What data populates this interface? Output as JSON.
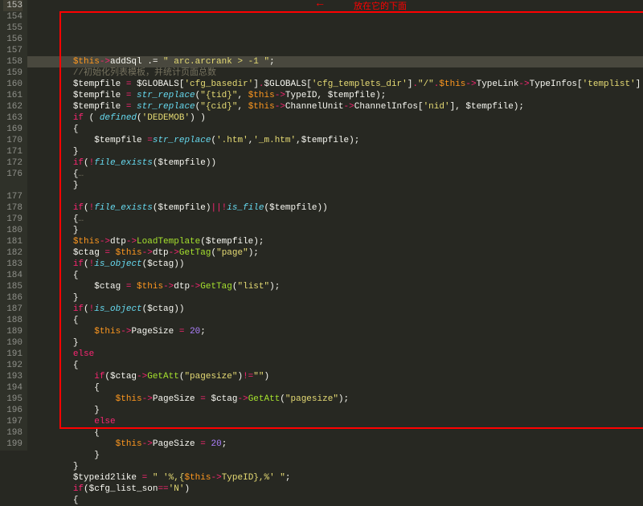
{
  "annotation": {
    "text": "放在它的下面",
    "arrow": "←"
  },
  "lines": [
    {
      "num": "153",
      "active": true,
      "sel": true,
      "tokens": [
        [
          "",
          "        "
        ],
        [
          "orange",
          "$this"
        ],
        [
          "red",
          "->"
        ],
        [
          "white",
          "addSql"
        ],
        [
          "white",
          " .= "
        ],
        [
          "yellow",
          "\" arc.arcrank > -1 \""
        ],
        [
          "white",
          ";"
        ]
      ]
    },
    {
      "num": "154",
      "tokens": [
        [
          "",
          "        "
        ],
        [
          "gray",
          "//初始化列表模板，并统计页面总数"
        ]
      ]
    },
    {
      "num": "155",
      "tokens": [
        [
          "",
          "        "
        ],
        [
          "white",
          "$tempfile "
        ],
        [
          "red",
          "="
        ],
        [
          "white",
          " $GLOBALS["
        ],
        [
          "yellow",
          "'cfg_basedir'"
        ],
        [
          "white",
          "]"
        ],
        [
          "red",
          "."
        ],
        [
          "white",
          "$GLOBALS["
        ],
        [
          "yellow",
          "'cfg_templets_dir'"
        ],
        [
          "white",
          "]"
        ],
        [
          "red",
          "."
        ],
        [
          "yellow",
          "\"/\""
        ],
        [
          "red",
          "."
        ],
        [
          "orange",
          "$this"
        ],
        [
          "red",
          "->"
        ],
        [
          "white",
          "TypeLink"
        ],
        [
          "red",
          "->"
        ],
        [
          "white",
          "TypeInfos["
        ],
        [
          "yellow",
          "'templist'"
        ],
        [
          "white",
          "]"
        ]
      ]
    },
    {
      "num": "156",
      "tokens": [
        [
          "",
          "        "
        ],
        [
          "white",
          "$tempfile "
        ],
        [
          "red",
          "="
        ],
        [
          "white",
          " "
        ],
        [
          "blue",
          "str_replace"
        ],
        [
          "white",
          "("
        ],
        [
          "yellow",
          "\"{tid}\""
        ],
        [
          "white",
          ", "
        ],
        [
          "orange",
          "$this"
        ],
        [
          "red",
          "->"
        ],
        [
          "white",
          "TypeID, $tempfile);"
        ]
      ]
    },
    {
      "num": "157",
      "tokens": [
        [
          "",
          "        "
        ],
        [
          "white",
          "$tempfile "
        ],
        [
          "red",
          "="
        ],
        [
          "white",
          " "
        ],
        [
          "blue",
          "str_replace"
        ],
        [
          "white",
          "("
        ],
        [
          "yellow",
          "\"{cid}\""
        ],
        [
          "white",
          ", "
        ],
        [
          "orange",
          "$this"
        ],
        [
          "red",
          "->"
        ],
        [
          "white",
          "ChannelUnit"
        ],
        [
          "red",
          "->"
        ],
        [
          "white",
          "ChannelInfos["
        ],
        [
          "yellow",
          "'nid'"
        ],
        [
          "white",
          "], $tempfile);"
        ]
      ]
    },
    {
      "num": "158",
      "tokens": [
        [
          "",
          "        "
        ],
        [
          "red",
          "if"
        ],
        [
          "white",
          " ( "
        ],
        [
          "blue",
          "defined"
        ],
        [
          "white",
          "("
        ],
        [
          "yellow",
          "'DEDEMOB'"
        ],
        [
          "white",
          ") )"
        ]
      ]
    },
    {
      "num": "159",
      "tokens": [
        [
          "",
          "        "
        ],
        [
          "white",
          "{"
        ]
      ]
    },
    {
      "num": "160",
      "tokens": [
        [
          "",
          "            "
        ],
        [
          "white",
          "$tempfile "
        ],
        [
          "red",
          "="
        ],
        [
          "blue",
          "str_replace"
        ],
        [
          "white",
          "("
        ],
        [
          "yellow",
          "'.htm'"
        ],
        [
          "white",
          ","
        ],
        [
          "yellow",
          "'_m.htm'"
        ],
        [
          "white",
          ",$tempfile);"
        ]
      ]
    },
    {
      "num": "161",
      "tokens": [
        [
          "",
          "        "
        ],
        [
          "white",
          "}"
        ]
      ]
    },
    {
      "num": "162",
      "tokens": [
        [
          "",
          "        "
        ],
        [
          "red",
          "if"
        ],
        [
          "white",
          "("
        ],
        [
          "red",
          "!"
        ],
        [
          "blue",
          "file_exists"
        ],
        [
          "white",
          "($tempfile))"
        ]
      ]
    },
    {
      "num": "163",
      "tokens": [
        [
          "",
          "        "
        ],
        [
          "white",
          "{"
        ],
        [
          "gray",
          "…"
        ]
      ]
    },
    {
      "num": "169",
      "tokens": [
        [
          "",
          "        "
        ],
        [
          "white",
          "}"
        ]
      ]
    },
    {
      "num": "170",
      "tokens": [
        [
          "",
          ""
        ]
      ]
    },
    {
      "num": "171",
      "tokens": [
        [
          "",
          "        "
        ],
        [
          "red",
          "if"
        ],
        [
          "white",
          "("
        ],
        [
          "red",
          "!"
        ],
        [
          "blue",
          "file_exists"
        ],
        [
          "white",
          "($tempfile)"
        ],
        [
          "red",
          "||!"
        ],
        [
          "blue",
          "is_file"
        ],
        [
          "white",
          "($tempfile))"
        ]
      ]
    },
    {
      "num": "172",
      "tokens": [
        [
          "",
          "        "
        ],
        [
          "white",
          "{"
        ],
        [
          "gray",
          "…"
        ]
      ]
    },
    {
      "num": "176",
      "tokens": [
        [
          "",
          "        "
        ],
        [
          "white",
          "}"
        ]
      ]
    },
    {
      "num": "176b",
      "num_display": "176",
      "skip_num": true,
      "tokens": [
        [
          "",
          "        "
        ],
        [
          "orange",
          "$this"
        ],
        [
          "red",
          "->"
        ],
        [
          "white",
          "dtp"
        ],
        [
          "red",
          "->"
        ],
        [
          "green",
          "LoadTemplate"
        ],
        [
          "white",
          "($tempfile);"
        ]
      ]
    },
    {
      "num": "177",
      "tokens": [
        [
          "",
          "        "
        ],
        [
          "white",
          "$ctag "
        ],
        [
          "red",
          "="
        ],
        [
          "white",
          " "
        ],
        [
          "orange",
          "$this"
        ],
        [
          "red",
          "->"
        ],
        [
          "white",
          "dtp"
        ],
        [
          "red",
          "->"
        ],
        [
          "green",
          "GetTag"
        ],
        [
          "white",
          "("
        ],
        [
          "yellow",
          "\"page\""
        ],
        [
          "white",
          ");"
        ]
      ]
    },
    {
      "num": "178",
      "tokens": [
        [
          "",
          "        "
        ],
        [
          "red",
          "if"
        ],
        [
          "white",
          "("
        ],
        [
          "red",
          "!"
        ],
        [
          "blue",
          "is_object"
        ],
        [
          "white",
          "($ctag))"
        ]
      ]
    },
    {
      "num": "179",
      "tokens": [
        [
          "",
          "        "
        ],
        [
          "white",
          "{"
        ]
      ]
    },
    {
      "num": "180",
      "tokens": [
        [
          "",
          "            "
        ],
        [
          "white",
          "$ctag "
        ],
        [
          "red",
          "="
        ],
        [
          "white",
          " "
        ],
        [
          "orange",
          "$this"
        ],
        [
          "red",
          "->"
        ],
        [
          "white",
          "dtp"
        ],
        [
          "red",
          "->"
        ],
        [
          "green",
          "GetTag"
        ],
        [
          "white",
          "("
        ],
        [
          "yellow",
          "\"list\""
        ],
        [
          "white",
          ");"
        ]
      ]
    },
    {
      "num": "181",
      "tokens": [
        [
          "",
          "        "
        ],
        [
          "white",
          "}"
        ]
      ]
    },
    {
      "num": "182",
      "tokens": [
        [
          "",
          "        "
        ],
        [
          "red",
          "if"
        ],
        [
          "white",
          "("
        ],
        [
          "red",
          "!"
        ],
        [
          "blue",
          "is_object"
        ],
        [
          "white",
          "($ctag))"
        ]
      ]
    },
    {
      "num": "183",
      "tokens": [
        [
          "",
          "        "
        ],
        [
          "white",
          "{"
        ]
      ]
    },
    {
      "num": "184",
      "tokens": [
        [
          "",
          "            "
        ],
        [
          "orange",
          "$this"
        ],
        [
          "red",
          "->"
        ],
        [
          "white",
          "PageSize "
        ],
        [
          "red",
          "="
        ],
        [
          "white",
          " "
        ],
        [
          "purple",
          "20"
        ],
        [
          "white",
          ";"
        ]
      ]
    },
    {
      "num": "185",
      "tokens": [
        [
          "",
          "        "
        ],
        [
          "white",
          "}"
        ]
      ]
    },
    {
      "num": "186",
      "tokens": [
        [
          "",
          "        "
        ],
        [
          "red",
          "else"
        ]
      ]
    },
    {
      "num": "187",
      "tokens": [
        [
          "",
          "        "
        ],
        [
          "white",
          "{"
        ]
      ]
    },
    {
      "num": "188",
      "tokens": [
        [
          "",
          "            "
        ],
        [
          "red",
          "if"
        ],
        [
          "white",
          "($ctag"
        ],
        [
          "red",
          "->"
        ],
        [
          "green",
          "GetAtt"
        ],
        [
          "white",
          "("
        ],
        [
          "yellow",
          "\"pagesize\""
        ],
        [
          "white",
          ")"
        ],
        [
          "red",
          "!="
        ],
        [
          "yellow",
          "\"\""
        ],
        [
          "white",
          ")"
        ]
      ]
    },
    {
      "num": "189",
      "tokens": [
        [
          "",
          "            "
        ],
        [
          "white",
          "{"
        ]
      ]
    },
    {
      "num": "190",
      "tokens": [
        [
          "",
          "                "
        ],
        [
          "orange",
          "$this"
        ],
        [
          "red",
          "->"
        ],
        [
          "white",
          "PageSize "
        ],
        [
          "red",
          "="
        ],
        [
          "white",
          " $ctag"
        ],
        [
          "red",
          "->"
        ],
        [
          "green",
          "GetAtt"
        ],
        [
          "white",
          "("
        ],
        [
          "yellow",
          "\"pagesize\""
        ],
        [
          "white",
          ");"
        ]
      ]
    },
    {
      "num": "191",
      "tokens": [
        [
          "",
          "            "
        ],
        [
          "white",
          "}"
        ]
      ]
    },
    {
      "num": "192",
      "tokens": [
        [
          "",
          "            "
        ],
        [
          "red",
          "else"
        ]
      ]
    },
    {
      "num": "193",
      "tokens": [
        [
          "",
          "            "
        ],
        [
          "white",
          "{"
        ]
      ]
    },
    {
      "num": "194",
      "tokens": [
        [
          "",
          "                "
        ],
        [
          "orange",
          "$this"
        ],
        [
          "red",
          "->"
        ],
        [
          "white",
          "PageSize "
        ],
        [
          "red",
          "="
        ],
        [
          "white",
          " "
        ],
        [
          "purple",
          "20"
        ],
        [
          "white",
          ";"
        ]
      ]
    },
    {
      "num": "195",
      "tokens": [
        [
          "",
          "            "
        ],
        [
          "white",
          "}"
        ]
      ]
    },
    {
      "num": "196",
      "tokens": [
        [
          "",
          "        "
        ],
        [
          "white",
          "}"
        ]
      ]
    },
    {
      "num": "197",
      "tokens": [
        [
          "",
          "        "
        ],
        [
          "white",
          "$typeid2like "
        ],
        [
          "red",
          "="
        ],
        [
          "white",
          " "
        ],
        [
          "yellow",
          "\" '%,{"
        ],
        [
          "orange",
          "$this"
        ],
        [
          "red",
          "->"
        ],
        [
          "yellow",
          "TypeID},%' \""
        ],
        [
          "white",
          ";"
        ]
      ]
    },
    {
      "num": "198",
      "tokens": [
        [
          "",
          "        "
        ],
        [
          "red",
          "if"
        ],
        [
          "white",
          "($cfg_list_son"
        ],
        [
          "red",
          "=="
        ],
        [
          "yellow",
          "'N'"
        ],
        [
          "white",
          ")"
        ]
      ]
    },
    {
      "num": "199",
      "tokens": [
        [
          "",
          "        "
        ],
        [
          "white",
          "{"
        ]
      ]
    }
  ]
}
